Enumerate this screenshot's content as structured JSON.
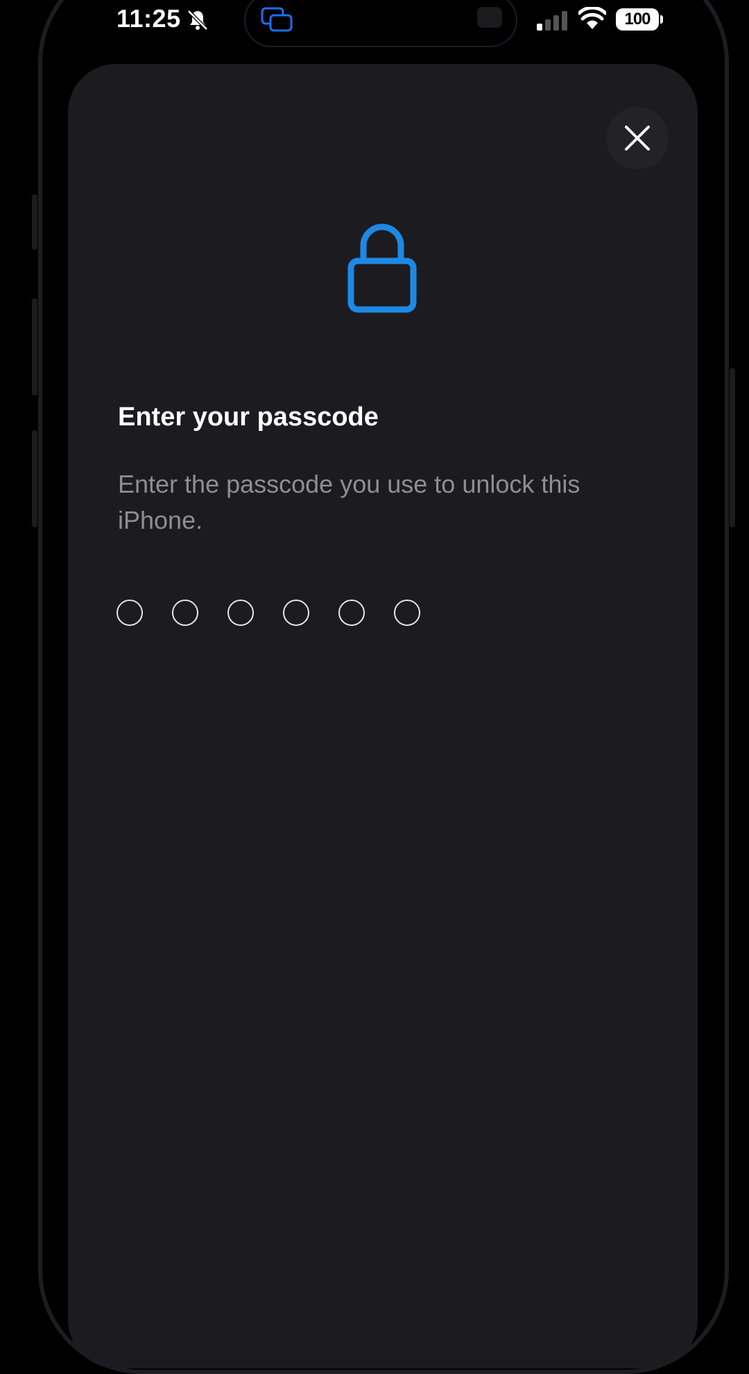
{
  "status_bar": {
    "time": "11:25",
    "battery": "100",
    "icons": [
      "bell-slash-icon",
      "screen-mirror-icon",
      "signal-icon",
      "wifi-icon",
      "battery-icon"
    ]
  },
  "sheet": {
    "close_icon": "close-icon",
    "lock_icon": "lock-icon",
    "title": "Enter your passcode",
    "subtitle": "Enter the passcode you use to unlock this iPhone.",
    "passcode": {
      "length": 6,
      "entered": 0
    }
  },
  "colors": {
    "accent": "#1e88e5",
    "sheet_background": "#1c1b1f",
    "title": "#ffffff",
    "subtitle": "#8e8e93"
  }
}
